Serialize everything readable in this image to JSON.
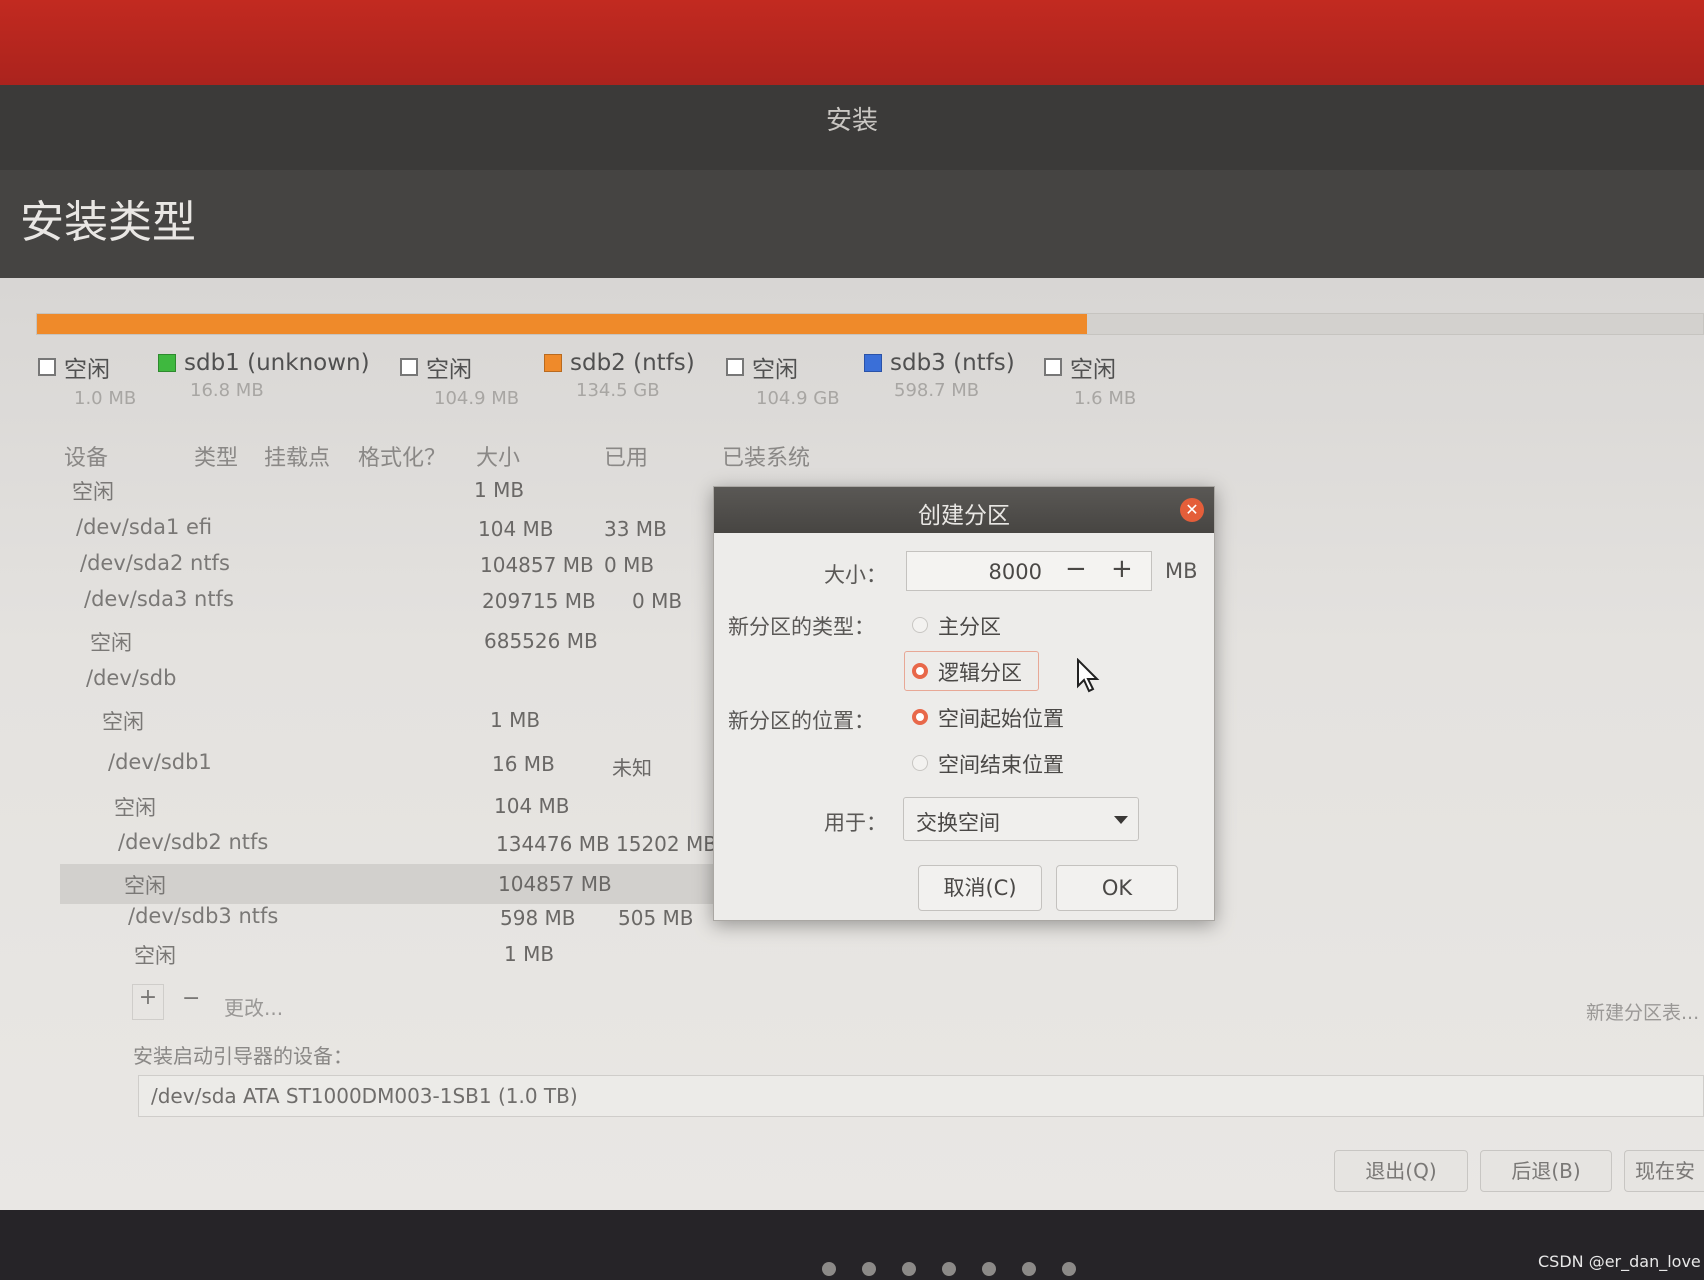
{
  "window": {
    "title": "安装"
  },
  "page": {
    "title": "安装类型"
  },
  "partition_bar": {
    "used_fraction": 0.63
  },
  "legend": [
    {
      "name": "空闲",
      "size": "1.0 MB",
      "color": "#ffffff",
      "checkbox": true
    },
    {
      "name": "sdb1 (unknown)",
      "size": "16.8 MB",
      "color": "#3fb83f",
      "checkbox": false
    },
    {
      "name": "空闲",
      "size": "104.9 MB",
      "color": "#ffffff",
      "checkbox": true
    },
    {
      "name": "sdb2 (ntfs)",
      "size": "134.5 GB",
      "color": "#ef8a2a",
      "checkbox": false
    },
    {
      "name": "空闲",
      "size": "104.9 GB",
      "color": "#ffffff",
      "checkbox": true
    },
    {
      "name": "sdb3 (ntfs)",
      "size": "598.7 MB",
      "color": "#3a6fd8",
      "checkbox": false
    },
    {
      "name": "空闲",
      "size": "1.6 MB",
      "color": "#ffffff",
      "checkbox": true
    }
  ],
  "table": {
    "headers": {
      "device": "设备",
      "type": "类型",
      "mount": "挂载点",
      "format": "格式化？",
      "size": "大小",
      "used": "已用",
      "system": "已装系统"
    },
    "rows": [
      {
        "device": "空闲",
        "size": "1 MB",
        "used": ""
      },
      {
        "device": "/dev/sda1  efi",
        "size": "104 MB",
        "used": "33 MB"
      },
      {
        "device": "/dev/sda2  ntfs",
        "size": "104857 MB",
        "used": "0 MB"
      },
      {
        "device": "/dev/sda3  ntfs",
        "size": "209715 MB",
        "used": "0 MB"
      },
      {
        "device": "空闲",
        "size": "685526 MB",
        "used": ""
      },
      {
        "device": "/dev/sdb",
        "size": "",
        "used": ""
      },
      {
        "device": "空闲",
        "size": "1 MB",
        "used": ""
      },
      {
        "device": "/dev/sdb1",
        "size": "16 MB",
        "used": "未知"
      },
      {
        "device": "空闲",
        "size": "104 MB",
        "used": ""
      },
      {
        "device": "/dev/sdb2  ntfs",
        "size": "134476 MB",
        "used": "15202 MB"
      },
      {
        "device": "空闲",
        "size": "104857 MB",
        "used": ""
      },
      {
        "device": "/dev/sdb3  ntfs",
        "size": "598 MB",
        "used": "505 MB"
      },
      {
        "device": "空闲",
        "size": "1 MB",
        "used": ""
      }
    ]
  },
  "toolbar": {
    "add": "+",
    "remove": "−",
    "change": "更改..."
  },
  "new_partition_table": "新建分区表...",
  "boot_loader": {
    "label": "安装启动引导器的设备：",
    "value": "/dev/sda   ATA ST1000DM003-1SB1 (1.0 TB)"
  },
  "buttons": {
    "quit": "退出(Q)",
    "back": "后退(B)",
    "install_now": "现在安"
  },
  "dialog": {
    "title": "创建分区",
    "size_label": "大小：",
    "size_value": "8000",
    "size_unit": "MB",
    "minus": "−",
    "plus": "+",
    "type_label": "新分区的类型：",
    "type_primary": "主分区",
    "type_logical": "逻辑分区",
    "location_label": "新分区的位置：",
    "location_start": "空间起始位置",
    "location_end": "空间结束位置",
    "use_label": "用于：",
    "use_value": "交换空间",
    "cancel": "取消(C)",
    "ok": "OK"
  },
  "watermark": "CSDN @er_dan_love"
}
